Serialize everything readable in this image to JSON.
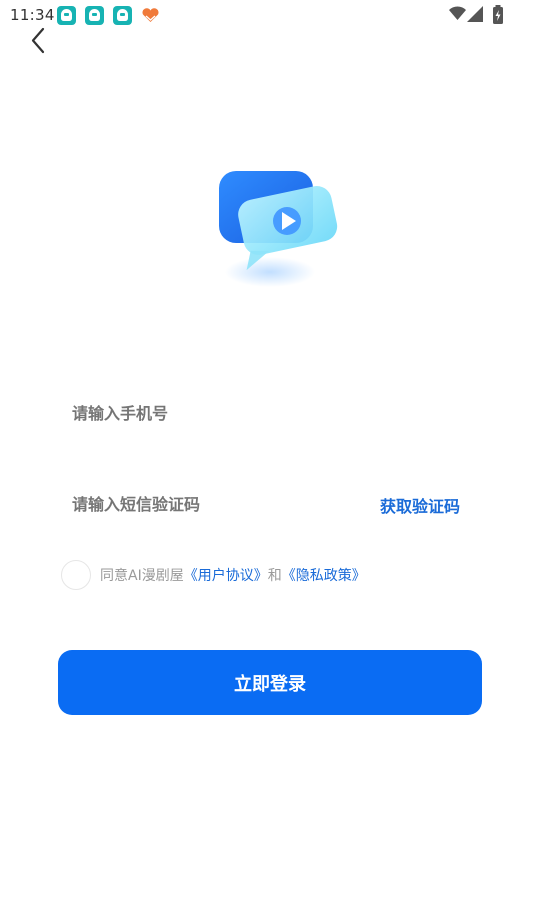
{
  "status_bar": {
    "time": "11:34",
    "icons": [
      "app-notification-icon",
      "app-notification-icon",
      "app-notification-icon",
      "heart-hands-icon",
      "wifi-icon",
      "signal-icon",
      "battery-charging-icon"
    ]
  },
  "nav": {
    "back_icon": "chevron-left-icon"
  },
  "logo": {
    "icon": "video-play-chat-icon",
    "accent": "#2a7cf6"
  },
  "form": {
    "phone_placeholder": "请输入手机号",
    "code_placeholder": "请输入短信验证码",
    "get_code": "获取验证码"
  },
  "agreement": {
    "prefix": "同意AI漫剧屋",
    "user_agreement": "《用户协议》",
    "and": "和",
    "privacy_policy": "《隐私政策》"
  },
  "login_button": "立即登录",
  "colors": {
    "primary": "#0a6cf3",
    "link": "#1a6bd8",
    "placeholder": "#8a8a8a"
  }
}
